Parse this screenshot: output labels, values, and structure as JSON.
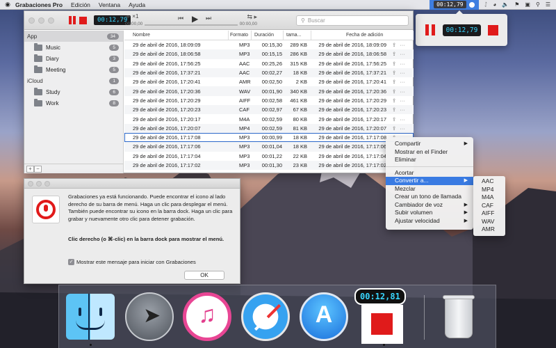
{
  "menubar": {
    "apple": "",
    "app_name": "Grabaciones Pro",
    "menus": [
      "Edición",
      "Ventana",
      "Ayuda"
    ],
    "recording_time": "00:12,79",
    "status_icons": [
      "record-dot-icon",
      "bluetooth-icon",
      "wifi-icon",
      "volume-icon",
      "flag-icon",
      "lock-icon",
      "search-icon",
      "menu-icon"
    ]
  },
  "mini_panel": {
    "time": "00:12,79"
  },
  "main_window": {
    "timer": "00:12,79",
    "player": {
      "speed": "×1",
      "start_time": "00:00,00",
      "end_time": "00:00,00"
    },
    "search_placeholder": "Buscar",
    "sidebar": {
      "groups": [
        {
          "label": "App",
          "count": "34",
          "children": [
            {
              "label": "Music",
              "count": "5"
            },
            {
              "label": "Diary",
              "count": "3"
            },
            {
              "label": "Meeting",
              "count": "5"
            }
          ]
        },
        {
          "label": "iCloud",
          "count": "1",
          "children": [
            {
              "label": "Study",
              "count": "6"
            },
            {
              "label": "Work",
              "count": "8"
            }
          ]
        }
      ],
      "footer": [
        "+",
        "−"
      ]
    },
    "table": {
      "columns": [
        "Nombre",
        "Formato",
        "Duración",
        "tama...",
        "Fecha de adición"
      ],
      "rows": [
        [
          "29 de abril de 2016, 18:09:09",
          "MP3",
          "00:15,30",
          "289 KB",
          "29 de abril de 2016, 18:09:09"
        ],
        [
          "29 de abril de 2016, 18:06:58",
          "MP3",
          "00:15,15",
          "286 KB",
          "29 de abril de 2016, 18:06:58"
        ],
        [
          "29 de abril de 2016, 17:56:25",
          "AAC",
          "00:25,26",
          "315 KB",
          "29 de abril de 2016, 17:56:25"
        ],
        [
          "29 de abril de 2016, 17:37:21",
          "AAC",
          "00:02,27",
          "18 KB",
          "29 de abril de 2016, 17:37:21"
        ],
        [
          "29 de abril de 2016, 17:20:41",
          "AMR",
          "00:02,50",
          "2 KB",
          "29 de abril de 2016, 17:20:41"
        ],
        [
          "29 de abril de 2016, 17:20:36",
          "WAV",
          "00:01,90",
          "340 KB",
          "29 de abril de 2016, 17:20:36"
        ],
        [
          "29 de abril de 2016, 17:20:29",
          "AIFF",
          "00:02,58",
          "461 KB",
          "29 de abril de 2016, 17:20:29"
        ],
        [
          "29 de abril de 2016, 17:20:23",
          "CAF",
          "00:02,97",
          "67 KB",
          "29 de abril de 2016, 17:20:23"
        ],
        [
          "29 de abril de 2016, 17:20:17",
          "M4A",
          "00:02,59",
          "80 KB",
          "29 de abril de 2016, 17:20:17"
        ],
        [
          "29 de abril de 2016, 17:20:07",
          "MP4",
          "00:02,59",
          "81 KB",
          "29 de abril de 2016, 17:20:07"
        ],
        [
          "29 de abril de 2016, 17:17:08",
          "MP3",
          "00:00,99",
          "18 KB",
          "29 de abril de 2016, 17:17:08"
        ],
        [
          "29 de abril de 2016, 17:17:06",
          "MP3",
          "00:01,04",
          "18 KB",
          "29 de abril de 2016, 17:17:06"
        ],
        [
          "29 de abril de 2016, 17:17:04",
          "MP3",
          "00:01,22",
          "22 KB",
          "29 de abril de 2016, 17:17:04"
        ],
        [
          "29 de abril de 2016, 17:17:02",
          "MP3",
          "00:01,30",
          "23 KB",
          "29 de abril de 2016, 17:17:02"
        ]
      ],
      "selected_row": 10
    }
  },
  "context_menu": {
    "items": [
      {
        "label": "Compartir",
        "submenu": true
      },
      {
        "label": "Mostrar en el Finder",
        "submenu": false
      },
      {
        "label": "Eliminar",
        "submenu": false
      },
      {
        "separator": true
      },
      {
        "label": "Acortar",
        "submenu": false
      },
      {
        "label": "Convertir a...",
        "submenu": true,
        "highlight": true
      },
      {
        "label": "Mezclar",
        "submenu": false
      },
      {
        "label": "Crear un tono de llamada",
        "submenu": false
      },
      {
        "label": "Cambiador de voz",
        "submenu": true
      },
      {
        "label": "Subir volumen",
        "submenu": true
      },
      {
        "label": "Ajustar velocidad",
        "submenu": true
      }
    ],
    "submenu": [
      "AAC",
      "MP4",
      "M4A",
      "CAF",
      "AIFF",
      "WAV",
      "AMR"
    ]
  },
  "dialog": {
    "text": "Grabaciones ya está funcionando. Puede encontrar el icono al lado derecho de su barra de menú. Haga un clic para desplegar el menú. También puede encontrar su icono en la barra dock. Haga un clic para grabar y nuevamente otro clic para detener grabación.",
    "bold_text": "Clic derecho (o ⌘-clic) en la barra dock para mostrar el menú.",
    "checkbox_label": "Mostrar este mensaje para iniciar con Grabaciones",
    "checkbox_checked": true,
    "ok_label": "OK"
  },
  "dock": {
    "apps": [
      "Finder",
      "Launchpad",
      "iTunes",
      "Safari",
      "App Store",
      "Grabaciones",
      "Trash"
    ],
    "recording_time": "00:12,81"
  },
  "colors": {
    "record_red": "#e01b1b",
    "timer_cyan": "#38d6ff",
    "selection_blue": "#3a7be2"
  }
}
